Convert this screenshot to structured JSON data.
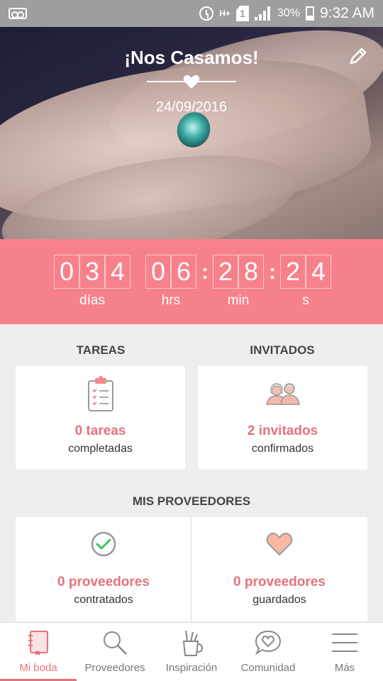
{
  "status_bar": {
    "hplus": "H+",
    "sim": "1",
    "battery_pct": "30%",
    "time": "9:32 AM",
    "icons": [
      "voicemail-icon",
      "alarm-icon",
      "hplus-icon",
      "sim-icon",
      "signal-icon",
      "battery-icon"
    ]
  },
  "hero": {
    "title": "¡Nos Casamos!",
    "date": "24/09/2016",
    "edit_icon": "pencil-icon"
  },
  "countdown": {
    "days": [
      "0",
      "3",
      "4"
    ],
    "hours": [
      "0",
      "6"
    ],
    "minutes": [
      "2",
      "8"
    ],
    "seconds": [
      "2",
      "4"
    ],
    "labels": {
      "days": "días",
      "hours": "hrs",
      "minutes": "min",
      "seconds": "s"
    }
  },
  "tareas": {
    "title": "TAREAS",
    "value": "0 tareas",
    "caption": "completadas",
    "icon": "clipboard-icon"
  },
  "invitados": {
    "title": "INVITADOS",
    "value": "2 invitados",
    "caption": "confirmados",
    "icon": "couple-icon"
  },
  "proveedores": {
    "title": "MIS PROVEEDORES",
    "contratados": {
      "value": "0 proveedores",
      "caption": "contratados",
      "icon": "check-circle-icon"
    },
    "guardados": {
      "value": "0 proveedores",
      "caption": "guardados",
      "icon": "heart-icon"
    }
  },
  "bottom_nav": {
    "items": [
      {
        "label": "Mi boda",
        "icon": "notebook-icon",
        "active": true
      },
      {
        "label": "Proveedores",
        "icon": "search-icon",
        "active": false
      },
      {
        "label": "Inspiración",
        "icon": "pencil-cup-icon",
        "active": false
      },
      {
        "label": "Comunidad",
        "icon": "chat-heart-icon",
        "active": false
      },
      {
        "label": "Más",
        "icon": "menu-icon",
        "active": false
      }
    ]
  },
  "colors": {
    "accent": "#e5727b",
    "countdown_bg": "#f7818a",
    "status_bar": "#9e9e9e",
    "background": "#eeeeee"
  }
}
